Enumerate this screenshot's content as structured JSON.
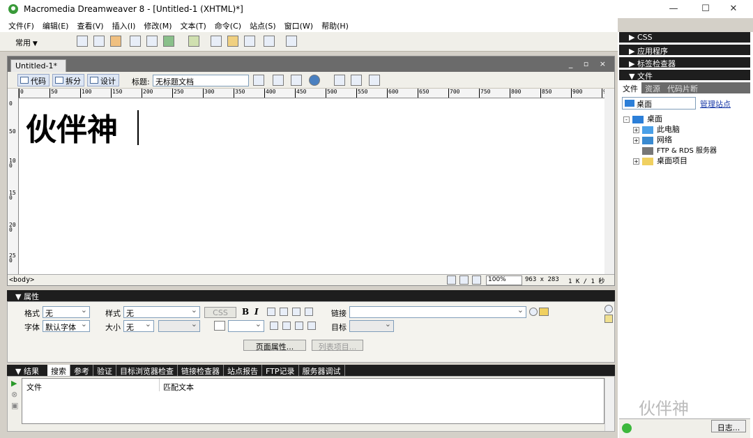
{
  "window": {
    "title": "Macromedia Dreamweaver 8 - [Untitled-1 (XHTML)*]",
    "minimize": "—",
    "maximize": "☐",
    "close": "✕"
  },
  "menu": [
    "文件(F)",
    "编辑(E)",
    "查看(V)",
    "插入(I)",
    "修改(M)",
    "文本(T)",
    "命令(C)",
    "站点(S)",
    "窗口(W)",
    "帮助(H)"
  ],
  "insertbar": {
    "category": "常用"
  },
  "document": {
    "tab": "Untitled-1*",
    "controls": "_ ▫ ×",
    "views": {
      "code": "代码",
      "split": "拆分",
      "design": "设计"
    },
    "title_label": "标题:",
    "title_value": "无标题文档",
    "ruler_ticks": [
      "0",
      "50",
      "100",
      "150",
      "200",
      "250",
      "300",
      "350",
      "400",
      "450",
      "500",
      "550",
      "600",
      "650",
      "700",
      "750",
      "800",
      "850",
      "900",
      "95"
    ],
    "vruler_ticks": [
      "0",
      "50",
      "100",
      "150",
      "200",
      "250"
    ],
    "content": "伙伴神",
    "tag_selector": "<body>",
    "zoom": "100%",
    "dimensions": "963 x 283",
    "size_time": "1 K / 1 秒"
  },
  "properties": {
    "title": "属性",
    "format_label": "格式",
    "format_value": "无",
    "style_label": "样式",
    "style_value": "无",
    "css_btn": "CSS",
    "bold": "B",
    "italic": "I",
    "link_label": "链接",
    "font_label": "字体",
    "font_value": "默认字体",
    "size_label": "大小",
    "size_value": "无",
    "target_label": "目标",
    "page_props": "页面属性...",
    "list_item": "列表项目..."
  },
  "results": {
    "title": "结果",
    "tabs": [
      "搜索",
      "参考",
      "验证",
      "目标浏览器检查",
      "链接检查器",
      "站点报告",
      "FTP记录",
      "服务器调试"
    ],
    "col_file": "文件",
    "col_match": "匹配文本"
  },
  "right_panel": {
    "css": "CSS",
    "app": "应用程序",
    "tag_inspector": "标签检查器",
    "files": "文件",
    "file_tabs": [
      "文件",
      "资源",
      "代码片断"
    ],
    "site": "桌面",
    "manage_site": "管理站点",
    "tree": [
      {
        "label": "桌面",
        "expander": "-"
      },
      {
        "label": "此电脑",
        "expander": "+"
      },
      {
        "label": "网络",
        "expander": "+"
      },
      {
        "label": "FTP & RDS 服务器",
        "expander": ""
      },
      {
        "label": "桌面项目",
        "expander": "+"
      }
    ],
    "log": "日志...",
    "watermark": "伙伴神"
  }
}
